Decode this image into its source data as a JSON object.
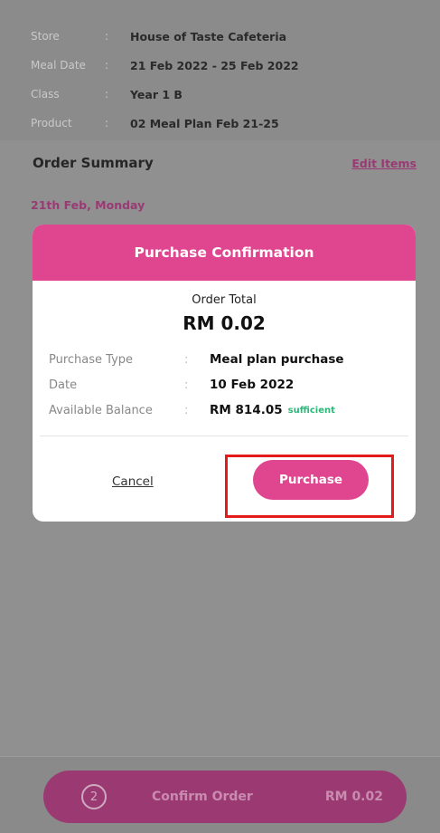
{
  "header": {
    "rows": [
      {
        "label": "Store",
        "value": "House of Taste Cafeteria"
      },
      {
        "label": "Meal Date",
        "value": "21 Feb 2022 - 25 Feb 2022"
      },
      {
        "label": "Class",
        "value": "Year 1 B"
      },
      {
        "label": "Product",
        "value": "02 Meal Plan Feb 21-25"
      }
    ],
    "separator": ":"
  },
  "summary": {
    "title": "Order Summary",
    "edit_label": "Edit Items",
    "day_label": "21th Feb, Monday"
  },
  "modal": {
    "title": "Purchase Confirmation",
    "order_total_label": "Order Total",
    "order_total_value": "RM 0.02",
    "details": [
      {
        "label": "Purchase Type",
        "value": "Meal plan purchase"
      },
      {
        "label": "Date",
        "value": "10 Feb 2022"
      },
      {
        "label": "Available Balance",
        "value": "RM 814.05",
        "note": "sufficient"
      }
    ],
    "cancel_label": "Cancel",
    "purchase_label": "Purchase"
  },
  "footer": {
    "step": "2",
    "confirm_label": "Confirm Order",
    "total": "RM 0.02"
  },
  "colors": {
    "accent": "#e0458f",
    "highlight": "#e31b1b",
    "sufficient": "#2db87a"
  }
}
